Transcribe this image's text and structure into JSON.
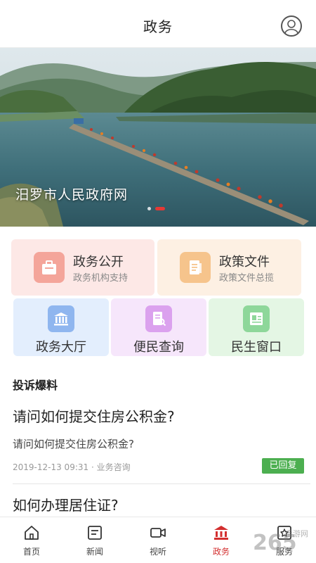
{
  "header": {
    "title": "政务"
  },
  "banner": {
    "caption": "汨罗市人民政府网",
    "slide_count": 2,
    "active_slide": 2
  },
  "cards_big": [
    {
      "title": "政务公开",
      "subtitle": "政务机构支持",
      "bg": "#fde8e6",
      "icon_bg": "#f4a59a"
    },
    {
      "title": "政策文件",
      "subtitle": "政策文件总揽",
      "bg": "#fdf0e3",
      "icon_bg": "#f6c48c"
    }
  ],
  "cards_small": [
    {
      "label": "政务大厅",
      "bg": "#e3eefd",
      "icon_bg": "#8fb6ef"
    },
    {
      "label": "便民查询",
      "bg": "#f6e6fb",
      "icon_bg": "#dba1ee"
    },
    {
      "label": "民生窗口",
      "bg": "#e4f6e4",
      "icon_bg": "#8ed79a"
    }
  ],
  "section": {
    "title": "投诉爆料"
  },
  "items": [
    {
      "question": "请问如何提交住房公积金?",
      "summary": "请问如何提交住房公积金?",
      "date": "2019-12-13 09:31",
      "category": "业务咨询",
      "status": "已回复",
      "status_color": "#4caf50"
    },
    {
      "question": "如何办理居住证?"
    }
  ],
  "tabbar": {
    "tabs": [
      {
        "label": "首页",
        "icon": "home-icon"
      },
      {
        "label": "新闻",
        "icon": "news-icon"
      },
      {
        "label": "视听",
        "icon": "video-icon"
      },
      {
        "label": "政务",
        "icon": "government-icon",
        "active": true
      },
      {
        "label": "服务",
        "icon": "service-icon"
      }
    ],
    "active_color": "#d32f2f"
  },
  "watermark": {
    "number": "265",
    "text": "手游网"
  }
}
